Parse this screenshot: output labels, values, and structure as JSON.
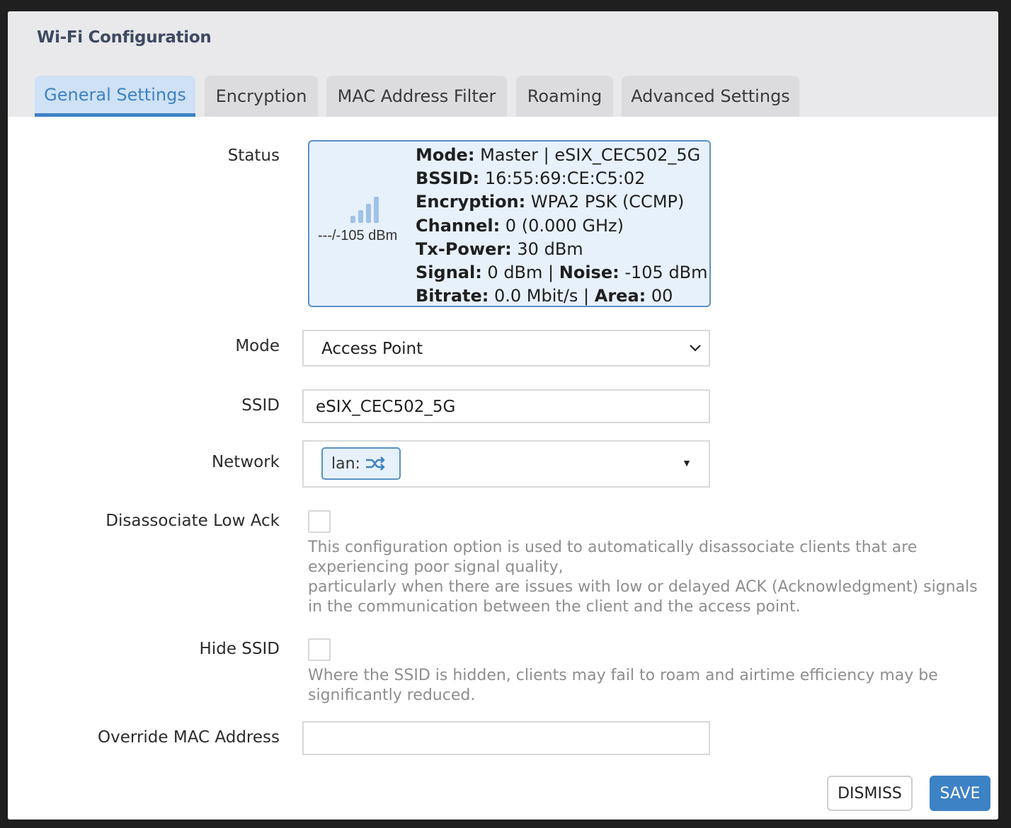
{
  "dialog": {
    "title": "Wi-Fi Configuration"
  },
  "tabs": [
    {
      "label": "General Settings",
      "active": true
    },
    {
      "label": "Encryption",
      "active": false
    },
    {
      "label": "MAC Address Filter",
      "active": false
    },
    {
      "label": "Roaming",
      "active": false
    },
    {
      "label": "Advanced Settings",
      "active": false
    }
  ],
  "status": {
    "label": "Status",
    "signal_text": "---/-105 dBm",
    "mode_key": "Mode:",
    "mode_val": " Master | eSIX_CEC502_5G",
    "bssid_key": "BSSID:",
    "bssid_val": " 16:55:69:CE:C5:02",
    "enc_key": "Encryption:",
    "enc_val": " WPA2 PSK (CCMP)",
    "channel_key": "Channel:",
    "channel_val": " 0 (0.000 GHz)",
    "tx_key": "Tx-Power:",
    "tx_val": " 30 dBm",
    "signal_key": "Signal:",
    "signal_val": " 0 dBm | ",
    "noise_key": "Noise:",
    "noise_val": " -105 dBm",
    "bitrate_key": "Bitrate:",
    "bitrate_val": " 0.0 Mbit/s | ",
    "area_key": "Area:",
    "area_val": " 00"
  },
  "mode": {
    "label": "Mode",
    "value": "Access Point"
  },
  "ssid": {
    "label": "SSID",
    "value": "eSIX_CEC502_5G"
  },
  "network": {
    "label": "Network",
    "tag": "lan:"
  },
  "disassoc": {
    "label": "Disassociate Low Ack",
    "help_1": "This configuration option is used to automatically disassociate clients that are experiencing poor signal quality,",
    "help_2": "particularly when there are issues with low or delayed ACK (Acknowledgment) signals in the communication between the client and the access point."
  },
  "hide_ssid": {
    "label": "Hide SSID",
    "help": "Where the SSID is hidden, clients may fail to roam and airtime efficiency may be significantly reduced."
  },
  "override_mac": {
    "label": "Override MAC Address",
    "value": ""
  },
  "footer": {
    "dismiss": "DISMISS",
    "save": "SAVE"
  },
  "colors": {
    "accent": "#3d82c4",
    "status_bg": "#e7f1fc",
    "header_bg": "#e9e9eb"
  }
}
